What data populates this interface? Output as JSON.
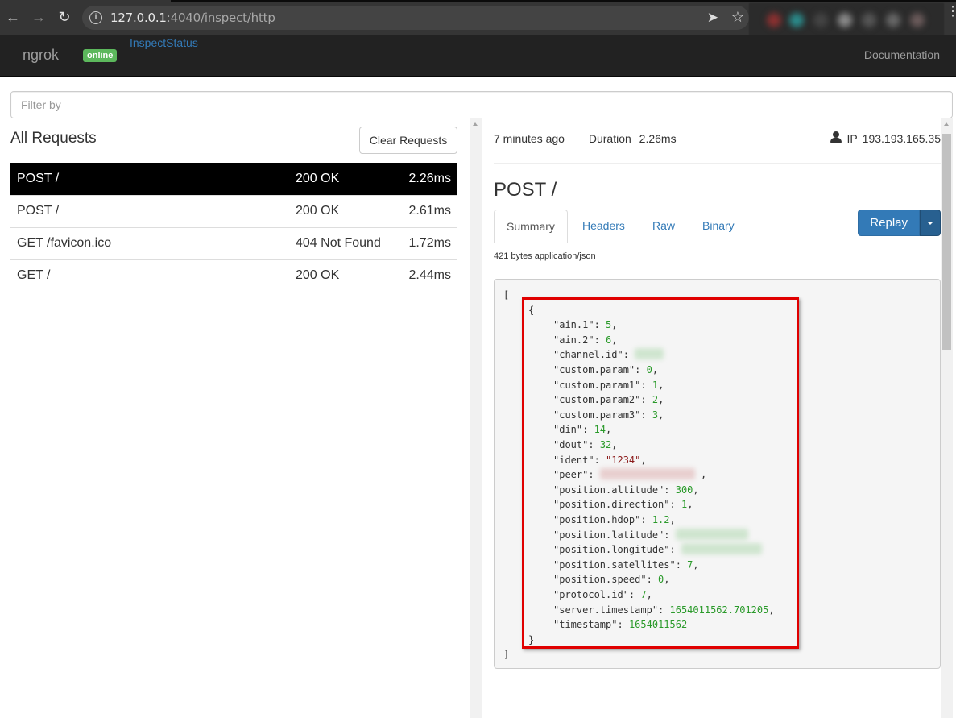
{
  "browser": {
    "url_host": "127.0.0.1",
    "url_rest": ":4040/inspect/http"
  },
  "navbar": {
    "brand": "ngrok",
    "status_badge": "online",
    "inspect_link": "InspectStatus",
    "docs_link": "Documentation"
  },
  "filter": {
    "placeholder": "Filter by",
    "value": ""
  },
  "requests": {
    "title": "All Requests",
    "clear_label": "Clear Requests",
    "rows": [
      {
        "path": "POST /",
        "status": "200 OK",
        "duration": "2.26ms",
        "selected": true
      },
      {
        "path": "POST /",
        "status": "200 OK",
        "duration": "2.61ms",
        "selected": false
      },
      {
        "path": "GET /favicon.ico",
        "status": "404 Not Found",
        "duration": "1.72ms",
        "selected": false
      },
      {
        "path": "GET /",
        "status": "200 OK",
        "duration": "2.44ms",
        "selected": false
      }
    ]
  },
  "detail": {
    "time_ago": "7 minutes ago",
    "duration_label": "Duration",
    "duration_value": "2.26ms",
    "ip_label": "IP",
    "ip_value": "193.193.165.35",
    "title": "POST /",
    "tabs": [
      "Summary",
      "Headers",
      "Raw",
      "Binary"
    ],
    "active_tab": "Summary",
    "replay_label": "Replay",
    "size_line": "421 bytes application/json",
    "body": {
      "open_bracket": "[",
      "open_brace": "{",
      "close_brace": "}",
      "close_bracket": "]",
      "fields": [
        {
          "key": "\"ain.1\"",
          "value": "5",
          "type": "n"
        },
        {
          "key": "\"ain.2\"",
          "value": "6",
          "type": "n"
        },
        {
          "key": "\"channel.id\"",
          "value": "",
          "type": "blur-green"
        },
        {
          "key": "\"custom.param\"",
          "value": "0",
          "type": "n"
        },
        {
          "key": "\"custom.param1\"",
          "value": "1",
          "type": "n"
        },
        {
          "key": "\"custom.param2\"",
          "value": "2",
          "type": "n"
        },
        {
          "key": "\"custom.param3\"",
          "value": "3",
          "type": "n"
        },
        {
          "key": "\"din\"",
          "value": "14",
          "type": "n"
        },
        {
          "key": "\"dout\"",
          "value": "32",
          "type": "n"
        },
        {
          "key": "\"ident\"",
          "value": "\"1234\"",
          "type": "s"
        },
        {
          "key": "\"peer\"",
          "value": "",
          "type": "blur-red"
        },
        {
          "key": "\"position.altitude\"",
          "value": "300",
          "type": "n"
        },
        {
          "key": "\"position.direction\"",
          "value": "1",
          "type": "n"
        },
        {
          "key": "\"position.hdop\"",
          "value": "1.2",
          "type": "n"
        },
        {
          "key": "\"position.latitude\"",
          "value": "",
          "type": "blur-green"
        },
        {
          "key": "\"position.longitude\"",
          "value": "",
          "type": "blur-green"
        },
        {
          "key": "\"position.satellites\"",
          "value": "7",
          "type": "n"
        },
        {
          "key": "\"position.speed\"",
          "value": "0",
          "type": "n"
        },
        {
          "key": "\"protocol.id\"",
          "value": "7",
          "type": "n"
        },
        {
          "key": "\"server.timestamp\"",
          "value": "1654011562.701205",
          "type": "n"
        },
        {
          "key": "\"timestamp\"",
          "value": "1654011562",
          "type": "n",
          "last": true
        }
      ]
    }
  }
}
